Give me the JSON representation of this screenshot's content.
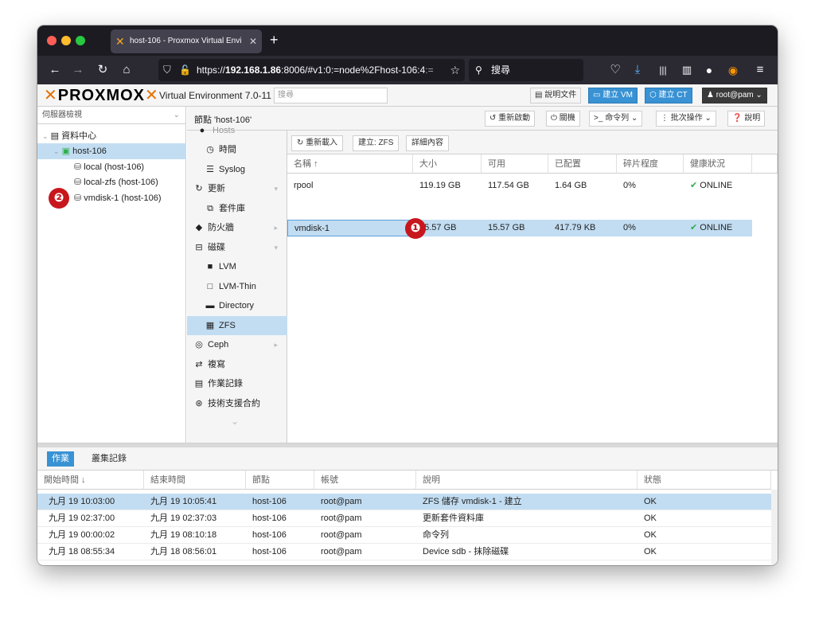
{
  "browser": {
    "tab_title": "host-106 - Proxmox Virtual Envi",
    "tab_icon": "proxmox-x-icon",
    "url_prefix": "https://",
    "url_host": "192.168.1.86",
    "url_rest": ":8006/#v1:0:=node%2Fhost-106:4",
    "url_faded": ":=",
    "search_label": "搜尋",
    "colors": {
      "tabbar": "#1c1b22",
      "navbar": "#2b2a33",
      "close": "#ff5f57",
      "minimize": "#febc2e",
      "zoom": "#28c840"
    }
  },
  "pve": {
    "logo_text": "PROXMOX",
    "version": "Virtual Environment 7.0-11",
    "search_placeholder": "搜尋",
    "docs_button": "說明文件",
    "create_vm_button": "建立 VM",
    "create_ct_button": "建立 CT",
    "user_button": "root@pam",
    "accent_color": "#3892d4",
    "brand_color": "#e57000"
  },
  "tree": {
    "view_select": "伺服器檢視",
    "datacenter": "資料中心",
    "node": "host-106",
    "storages": [
      "local (host-106)",
      "local-zfs (host-106)",
      "vmdisk-1 (host-106)"
    ]
  },
  "header": {
    "title": "節點 'host-106'",
    "restart": "重新啟動",
    "shutdown": "關機",
    "shell": "命令列",
    "bulk": "批次操作",
    "help": "說明"
  },
  "submenu": {
    "partial": "Hosts",
    "items": [
      "時間",
      "Syslog",
      "更新",
      "套件庫",
      "防火牆",
      "磁碟",
      "LVM",
      "LVM-Thin",
      "Directory",
      "ZFS",
      "Ceph",
      "複寫",
      "作業記錄",
      "技術支援合約"
    ]
  },
  "zfs": {
    "reload": "重新載入",
    "create": "建立: ZFS",
    "detail": "詳細內容",
    "columns": [
      "名稱 ↑",
      "大小",
      "可用",
      "已配置",
      "碎片程度",
      "健康狀況"
    ],
    "rows": [
      {
        "name": "rpool",
        "size": "119.19 GB",
        "free": "117.54 GB",
        "alloc": "1.64 GB",
        "frag": "0%",
        "health": "ONLINE"
      },
      {
        "name": "vmdisk-1",
        "size": "15.57 GB",
        "free": "15.57 GB",
        "alloc": "417.79 KB",
        "frag": "0%",
        "health": "ONLINE"
      }
    ]
  },
  "annotations": {
    "one": "❶",
    "two": "❷"
  },
  "tasks": {
    "tab_active": "作業",
    "tab_cluster": "叢集記錄",
    "columns": [
      "開始時間 ↓",
      "結束時間",
      "節點",
      "帳號",
      "說明",
      "狀態"
    ],
    "rows": [
      {
        "start": "九月 19 10:03:00",
        "end": "九月 19 10:05:41",
        "node": "host-106",
        "user": "root@pam",
        "desc": "ZFS 儲存 vmdisk-1 - 建立",
        "status": "OK"
      },
      {
        "start": "九月 19 02:37:00",
        "end": "九月 19 02:37:03",
        "node": "host-106",
        "user": "root@pam",
        "desc": "更新套件資料庫",
        "status": "OK"
      },
      {
        "start": "九月 19 00:00:02",
        "end": "九月 19 08:10:18",
        "node": "host-106",
        "user": "root@pam",
        "desc": "命令列",
        "status": "OK"
      },
      {
        "start": "九月 18 08:55:34",
        "end": "九月 18 08:56:01",
        "node": "host-106",
        "user": "root@pam",
        "desc": "Device sdb - 抹除磁碟",
        "status": "OK"
      }
    ]
  }
}
